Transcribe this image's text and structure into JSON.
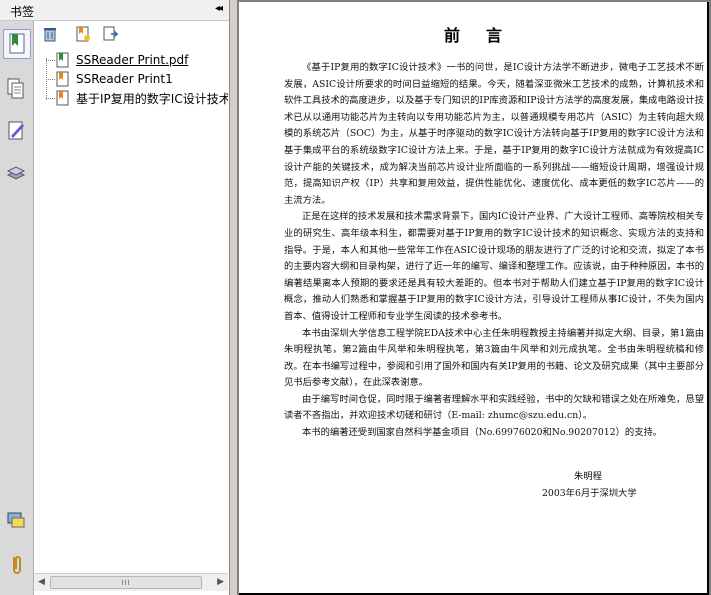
{
  "panel": {
    "title": "书签",
    "collapse_glyph": "◂◂",
    "side_icons": [
      "bookmarks-icon",
      "pages-icon",
      "signatures-icon",
      "layers-icon",
      "comments-icon",
      "attachments-icon"
    ],
    "toolbar_icons": [
      "delete-icon",
      "new-bookmark-icon",
      "expand-bookmark-icon"
    ],
    "bookmarks": [
      {
        "label": "SSReader Print.pdf",
        "underlined": true
      },
      {
        "label": "SSReader Print1",
        "underlined": false
      },
      {
        "label": "基于IP复用的数字IC设计技术",
        "underlined": false
      }
    ],
    "scroll_grip": "III"
  },
  "document": {
    "title": "前言",
    "paragraphs": [
      "《基于IP复用的数字IC设计技术》一书的问世，是IC设计方法学不断进步，微电子工艺技术不断发展，ASIC设计所要求的时间日益缩短的结果。今天，随着深亚微米工艺技术的成熟，计算机技术和软件工具技术的高度进步，以及基于专门知识的IP库资源和IP设计方法学的高度发展，集成电路设计技术已从以通用功能芯片为主转向以专用功能芯片为主，以普通规模专用芯片（ASIC）为主转向超大规模的系统芯片（SOC）为主，从基于时序驱动的数字IC设计方法转向基于IP复用的数字IC设计方法和基于集成平台的系统级数字IC设计方法上来。于是，基于IP复用的数字IC设计方法就成为有效提高IC设计产能的关键技术，成为解决当前芯片设计业所面临的一系列挑战——缩短设计周期，增强设计规范，提高知识产权（IP）共享和复用效益，提供性能优化、速度优化、成本更低的数字IC芯片——的主流方法。",
      "正是在这样的技术发展和技术需求背景下，国内IC设计产业界、广大设计工程师、高等院校相关专业的研究生、高年级本科生，都需要对基于IP复用的数字IC设计技术的知识概念、实现方法的支持和指导。于是，本人和其他一些常年工作在ASIC设计现场的朋友进行了广泛的讨论和交流，拟定了本书的主要内容大纲和目录构架，进行了近一年的编写、编译和整理工作。应该说，由于种种原因，本书的编著结果离本人预期的要求还是具有较大差距的。但本书对于帮助人们建立基于IP复用的数字IC设计概念，推动人们熟悉和掌握基于IP复用的数字IC设计方法，引导设计工程师从事IC设计，不失为国内首本、值得设计工程师和专业学生阅读的技术参考书。",
      "本书由深圳大学信息工程学院EDA技术中心主任朱明程教授主持编著并拟定大纲、目录，第1篇由朱明程执笔，第2篇由牛风举和朱明程执笔，第3篇由牛风举和刘元成执笔。全书由朱明程统稿和修改。在本书编写过程中，参阅和引用了国外和国内有关IP复用的书籍、论文及研究成果（其中主要部分见书后参考文献），在此深表谢意。",
      "由于编写时间仓促，同时限于编著者理解水平和实践经验，书中的欠缺和错误之处在所难免，恳望读者不吝指出，并欢迎技术切磋和研讨（E-mail: zhumc@szu.edu.cn）。",
      "本书的编著还受到国家自然科学基金项目（No.69976020和No.90207012）的支持。"
    ],
    "signature_name": "朱明程",
    "signature_date": "2003年6月于深圳大学"
  }
}
